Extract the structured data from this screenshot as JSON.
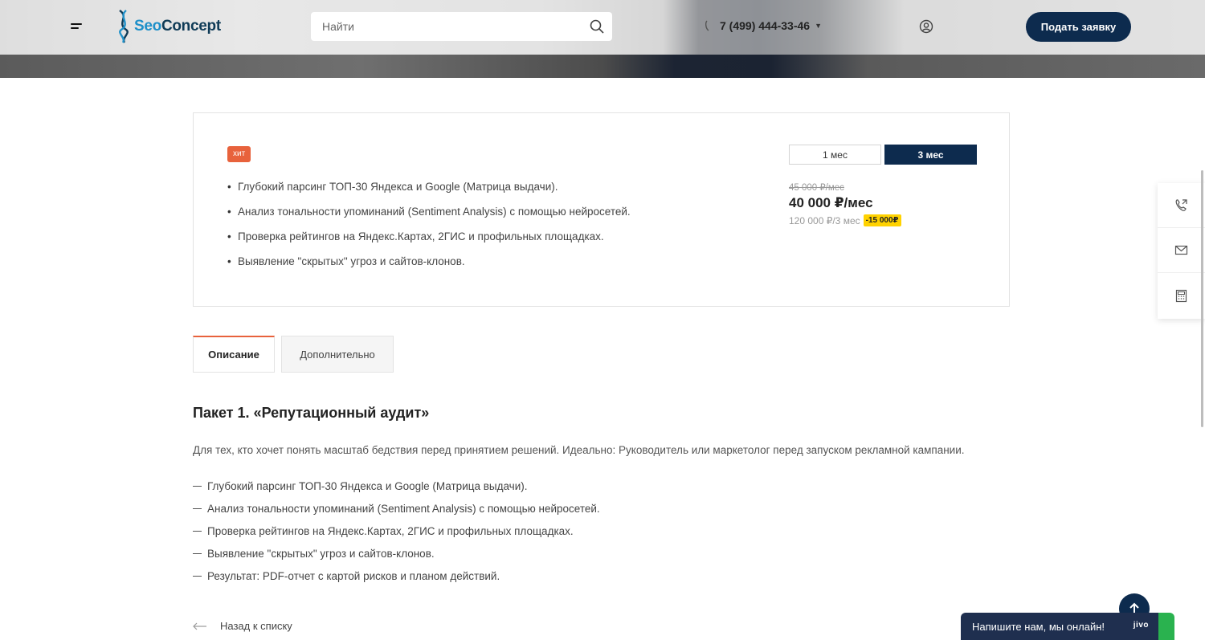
{
  "header": {
    "logo_seo": "Seo",
    "logo_concept": "Concept",
    "search_placeholder": "Найти",
    "phone": "7 (499) 444-33-46",
    "cta_label": "Подать заявку"
  },
  "package_card": {
    "badge": "хит",
    "features": [
      "Глубокий парсинг ТОП-30 Яндекса и Google (Матрица выдачи).",
      "Анализ тональности упоминаний (Sentiment Analysis) с помощью нейросетей.",
      "Проверка рейтингов на Яндекс.Картах, 2ГИС и профильных площадках.",
      "Выявление \"скрытых\" угроз и сайтов-клонов."
    ],
    "period_1": "1 мес",
    "period_3": "3 мес",
    "price_old": "45 000 ₽/мес",
    "price_main": "40 000 ₽/мес",
    "price_total": "120 000 ₽/3 мес",
    "discount": "-15 000₽"
  },
  "tabs": {
    "description": "Описание",
    "additional": "Дополнительно"
  },
  "content": {
    "title": "Пакет 1. «Репутационный аудит»",
    "lead": "Для тех, кто хочет понять масштаб бедствия перед принятием решений. Идеально: Руководитель или маркетолог перед запуском рекламной кампании.",
    "items": [
      "Глубокий парсинг ТОП-30 Яндекса и Google (Матрица выдачи).",
      "Анализ тональности упоминаний (Sentiment Analysis) с помощью нейросетей.",
      "Проверка рейтингов на Яндекс.Картах, 2ГИС и профильных площадках.",
      "Выявление \"скрытых\" угроз и сайтов-клонов.",
      "Результат: PDF-отчет с картой рисков и планом действий."
    ]
  },
  "back_link": "Назад к списку",
  "chat": {
    "label": "Напишите нам, мы онлайн!",
    "brand": "jivo"
  },
  "colors": {
    "primary": "#0d2b4e",
    "accent": "#e8623c",
    "discount": "#ffd200"
  },
  "icons": [
    "menu-icon",
    "search-icon",
    "phone-icon",
    "user-icon",
    "callback-icon",
    "mail-icon",
    "calculator-icon",
    "arrow-up-icon",
    "arrow-left-icon"
  ]
}
